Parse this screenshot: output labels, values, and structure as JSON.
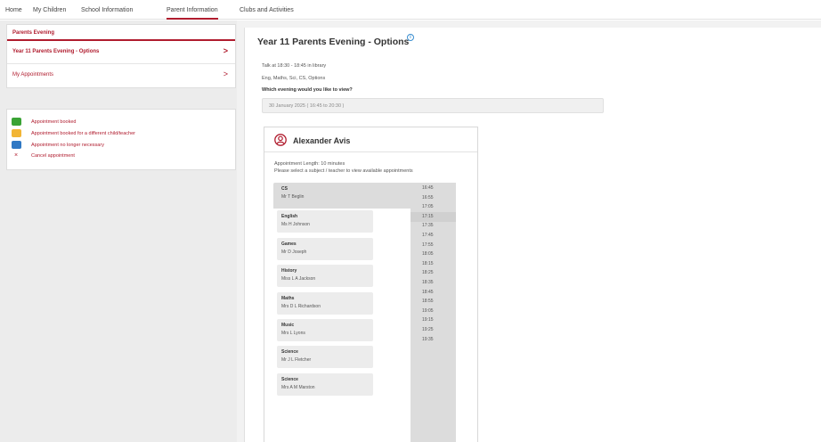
{
  "nav": {
    "tabs": [
      "Home",
      "My Children",
      "School Information",
      "Parent Information",
      "Clubs and Activities"
    ],
    "active_index": 3
  },
  "sidebar": {
    "heading": "Parents Evening",
    "items": [
      {
        "label": "Year 11 Parents Evening - Options",
        "chevron": ">"
      },
      {
        "label": "My Appointments",
        "chevron": ">"
      }
    ],
    "legend": [
      {
        "label": "Appointment booked",
        "color": "#3aa335"
      },
      {
        "label": "Appointment booked for a different child/teacher",
        "color": "#f2b535"
      },
      {
        "label": "Appointment no longer necessary",
        "color": "#2f78c4"
      }
    ],
    "cancel": {
      "symbol": "×",
      "label": "Cancel appointment"
    }
  },
  "main": {
    "title": "Year 11 Parents Evening - Options",
    "info_icon": "i",
    "lines": [
      "Talk at 18:30 - 18:45 in library",
      "Eng, Maths, Sci, CS, Options"
    ],
    "question": "Which evening would you like to view?",
    "selected_evening": "30 January 2025 ( 16:45 to 20:30 )",
    "student": {
      "name": "Alexander Avis",
      "appointment_length": "Appointment Length: 10 minutes",
      "instruction": "Please select a subject / teacher to view available appointments"
    },
    "subjects": [
      {
        "subject": "CS",
        "teacher": "Mr T Beglin"
      },
      {
        "subject": "English",
        "teacher": "Ms H Johnson"
      },
      {
        "subject": "Games",
        "teacher": "Mr D Joseph"
      },
      {
        "subject": "History",
        "teacher": "Miss L A Jackson"
      },
      {
        "subject": "Maths",
        "teacher": "Mrs D L Richardson"
      },
      {
        "subject": "Music",
        "teacher": "Mrs L Lyons"
      },
      {
        "subject": "Science",
        "teacher": "Mr J L Fletcher"
      },
      {
        "subject": "Science",
        "teacher": "Mrs A M Marston"
      }
    ],
    "times": [
      "16:45",
      "16:55",
      "17:05",
      "17:15",
      "17:35",
      "17:45",
      "17:55",
      "18:05",
      "18:15",
      "18:25",
      "18:35",
      "18:45",
      "18:55",
      "19:05",
      "19:15",
      "19:25",
      "19:35"
    ]
  },
  "colors": {
    "brand": "#b01c2e",
    "info": "#3a8ed0"
  }
}
